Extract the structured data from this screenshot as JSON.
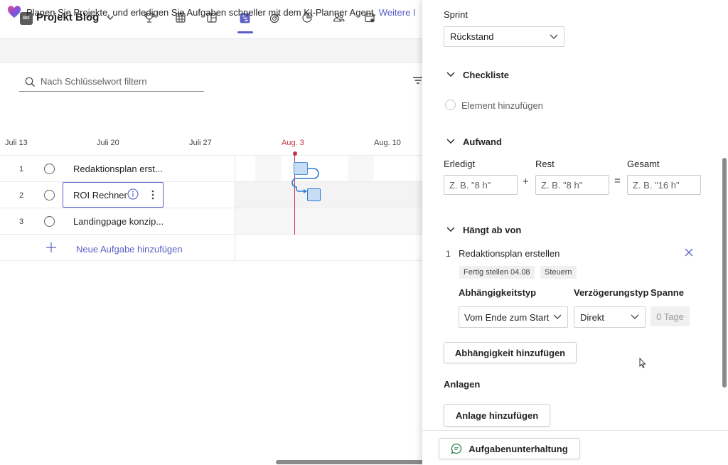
{
  "header": {
    "project_initials": "BO",
    "project_name": "Projekt Blog",
    "icons": [
      "trophy-icon",
      "grid-icon",
      "board-icon",
      "timeline-icon",
      "goals-icon",
      "charts-icon",
      "people-icon",
      "calendar-icon"
    ],
    "active_tab": "timeline-icon"
  },
  "banner": {
    "text": "Planen Sie Projekte, und erledigen Sie Aufgaben schneller mit dem KI-Planner Agent.",
    "link": "Weitere I"
  },
  "filter": {
    "placeholder": "Nach Schlüsselwort filtern"
  },
  "timeline": {
    "dates": [
      "Juli 13",
      "Juli 20",
      "Juli 27",
      "Aug. 3",
      "Aug. 10"
    ],
    "today": "Aug. 3"
  },
  "tasks": [
    {
      "num": "1",
      "title": "Redaktionsplan erst..."
    },
    {
      "num": "2",
      "title": "ROI Rechner"
    },
    {
      "num": "3",
      "title": "Landingpage konzip..."
    }
  ],
  "add_task": "Neue Aufgabe hinzufügen",
  "panel": {
    "sprint_label": "Sprint",
    "sprint_value": "Rückstand",
    "checklist_header": "Checkliste",
    "checklist_add": "Element hinzufügen",
    "effort_header": "Aufwand",
    "effort_done_label": "Erledigt",
    "effort_rest_label": "Rest",
    "effort_total_label": "Gesamt",
    "effort_done_placeholder": "Z. B. \"8 h\"",
    "effort_rest_placeholder": "Z. B. \"8 h\"",
    "effort_total_placeholder": "Z. B. \"16 h\"",
    "plus_sign": "+",
    "equals_sign": "=",
    "depends_header": "Hängt ab von",
    "dependency": {
      "num": "1",
      "title": "Redaktionsplan erstellen",
      "due_pill": "Fertig stellen 04.08",
      "bucket_pill": "Steuern",
      "type_label": "Abhängigkeitstyp",
      "delay_label": "Verzögerungstyp",
      "span_label": "Spanne",
      "type_value": "Vom Ende zum Start",
      "delay_value": "Direkt",
      "span_value": "0 Tage"
    },
    "add_dependency": "Abhängigkeit hinzufügen",
    "attachments_header": "Anlagen",
    "add_attachment": "Anlage hinzufügen",
    "conversation": "Aufgabenunterhaltung"
  }
}
